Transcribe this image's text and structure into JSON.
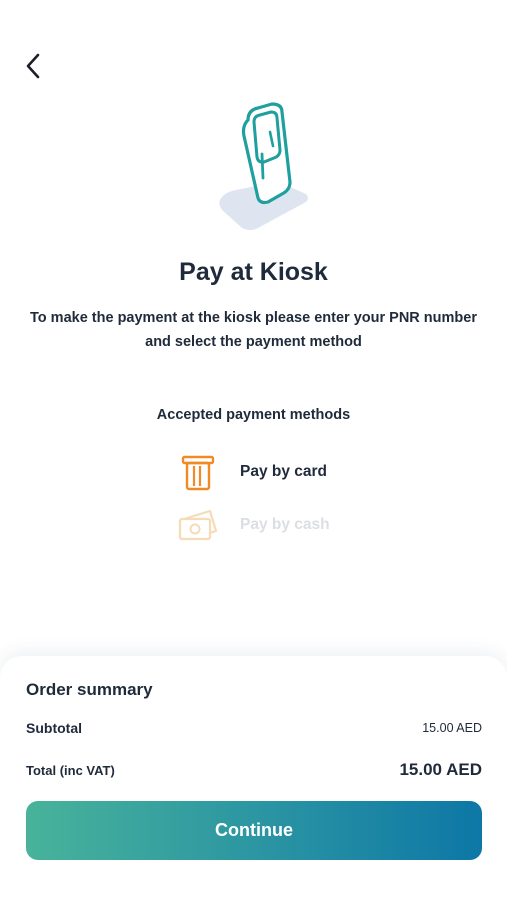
{
  "header": {
    "back_icon": "chevron-left-icon"
  },
  "hero": {
    "icon": "kiosk-illustration",
    "colors": {
      "teal": "#1f9f9e",
      "platform": "#dfe5f0"
    }
  },
  "title": "Pay at Kiosk",
  "subtitle": "To make the payment at the kiosk please enter your PNR number and select the payment method",
  "methods": {
    "heading": "Accepted payment methods",
    "items": [
      {
        "label": "Pay by card",
        "icon": "card-icon",
        "enabled": true,
        "color": "#f08a24"
      },
      {
        "label": "Pay by cash",
        "icon": "cash-icon",
        "enabled": false,
        "color": "#f3c07a"
      }
    ]
  },
  "summary": {
    "title": "Order summary",
    "subtotal_label": "Subtotal",
    "subtotal_value": "15.00 AED",
    "total_label": "Total (inc VAT)",
    "total_value": "15.00 AED"
  },
  "continue_label": "Continue",
  "accent_gradient": [
    "#48b39a",
    "#0d77a6"
  ]
}
